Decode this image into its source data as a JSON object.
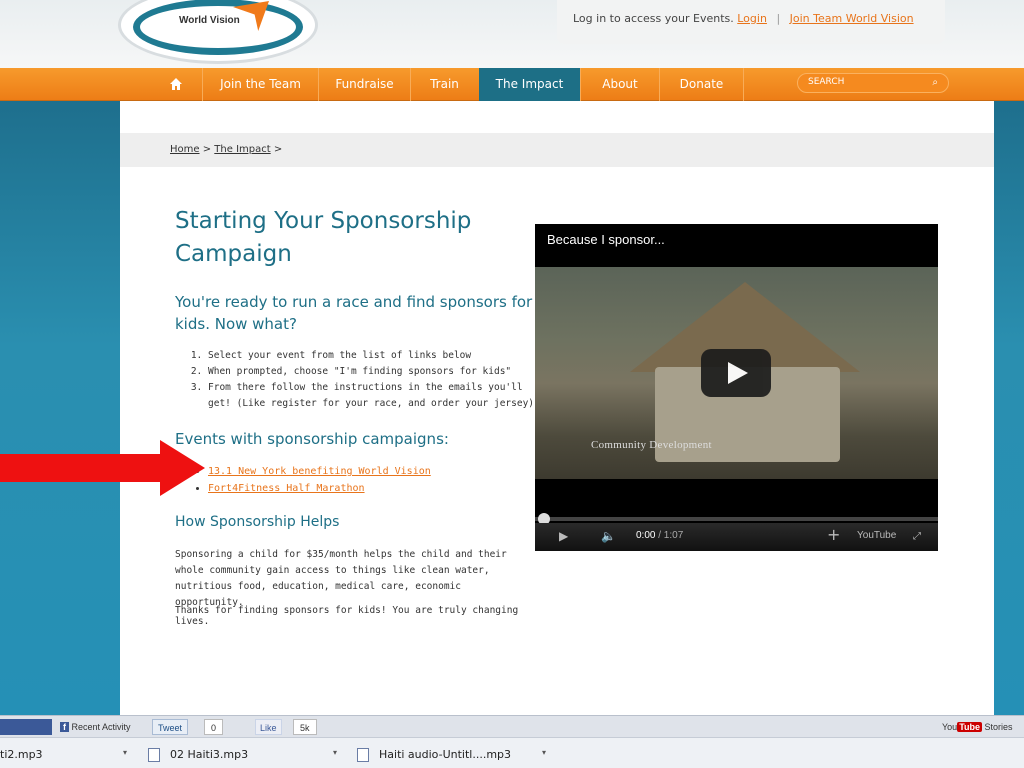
{
  "header": {
    "logo_text": "World Vision",
    "login_prompt": "Log in to access your Events.",
    "login_link": "Login",
    "separator": "|",
    "join_link": "Join Team World Vision"
  },
  "nav": {
    "items": [
      {
        "label": "Join the Team"
      },
      {
        "label": "Fundraise"
      },
      {
        "label": "Train"
      },
      {
        "label": "The Impact",
        "active": true
      },
      {
        "label": "About"
      },
      {
        "label": "Donate"
      }
    ],
    "search_placeholder": "SEARCH"
  },
  "breadcrumb": {
    "home": "Home",
    "sep1": ">",
    "current": "The Impact",
    "sep2": ">"
  },
  "main": {
    "title": "Starting Your Sponsorship Campaign",
    "subtitle": "You're ready to run a race and find sponsors for kids. Now what?",
    "steps": [
      "Select your event from the list of links below",
      "When prompted, choose \"I'm finding sponsors for kids\"",
      "From there follow the instructions in the emails you'll get! (Like register for your race, and order your jersey)"
    ],
    "events_heading": "Events with sponsorship campaigns:",
    "events": [
      "13.1 New York benefiting World Vision",
      "Fort4Fitness Half Marathon"
    ],
    "help_heading": "How Sponsorship Helps",
    "help_text": "Sponsoring a child for $35/month helps the child and their whole community gain access to things like clean water, nutritious food, education, medical care, economic opportunity.",
    "thanks_text": "Thanks for finding sponsors for kids! You are truly changing lives."
  },
  "video": {
    "title": "Because I sponsor...",
    "caption": "Community Development",
    "time_current": "0:00",
    "time_total": "/ 1:07",
    "youtube_label": "YouTube",
    "progress_fraction": 0.0
  },
  "social_bar": {
    "recent_activity": "Recent Activity",
    "tweet": "Tweet",
    "tweet_count": "0",
    "like": "Like",
    "like_count": "5k",
    "yt_you": "You",
    "yt_tube": "Tube",
    "stories": "Stories"
  },
  "downloads": [
    {
      "name": "ti2.mp3"
    },
    {
      "name": "02 Haiti3.mp3"
    },
    {
      "name": "Haiti audio-Untitl....mp3"
    }
  ],
  "colors": {
    "brand_orange": "#f08a1f",
    "brand_teal": "#1e6f86",
    "link_orange": "#e8741b",
    "arrow_red": "#ee1111"
  }
}
